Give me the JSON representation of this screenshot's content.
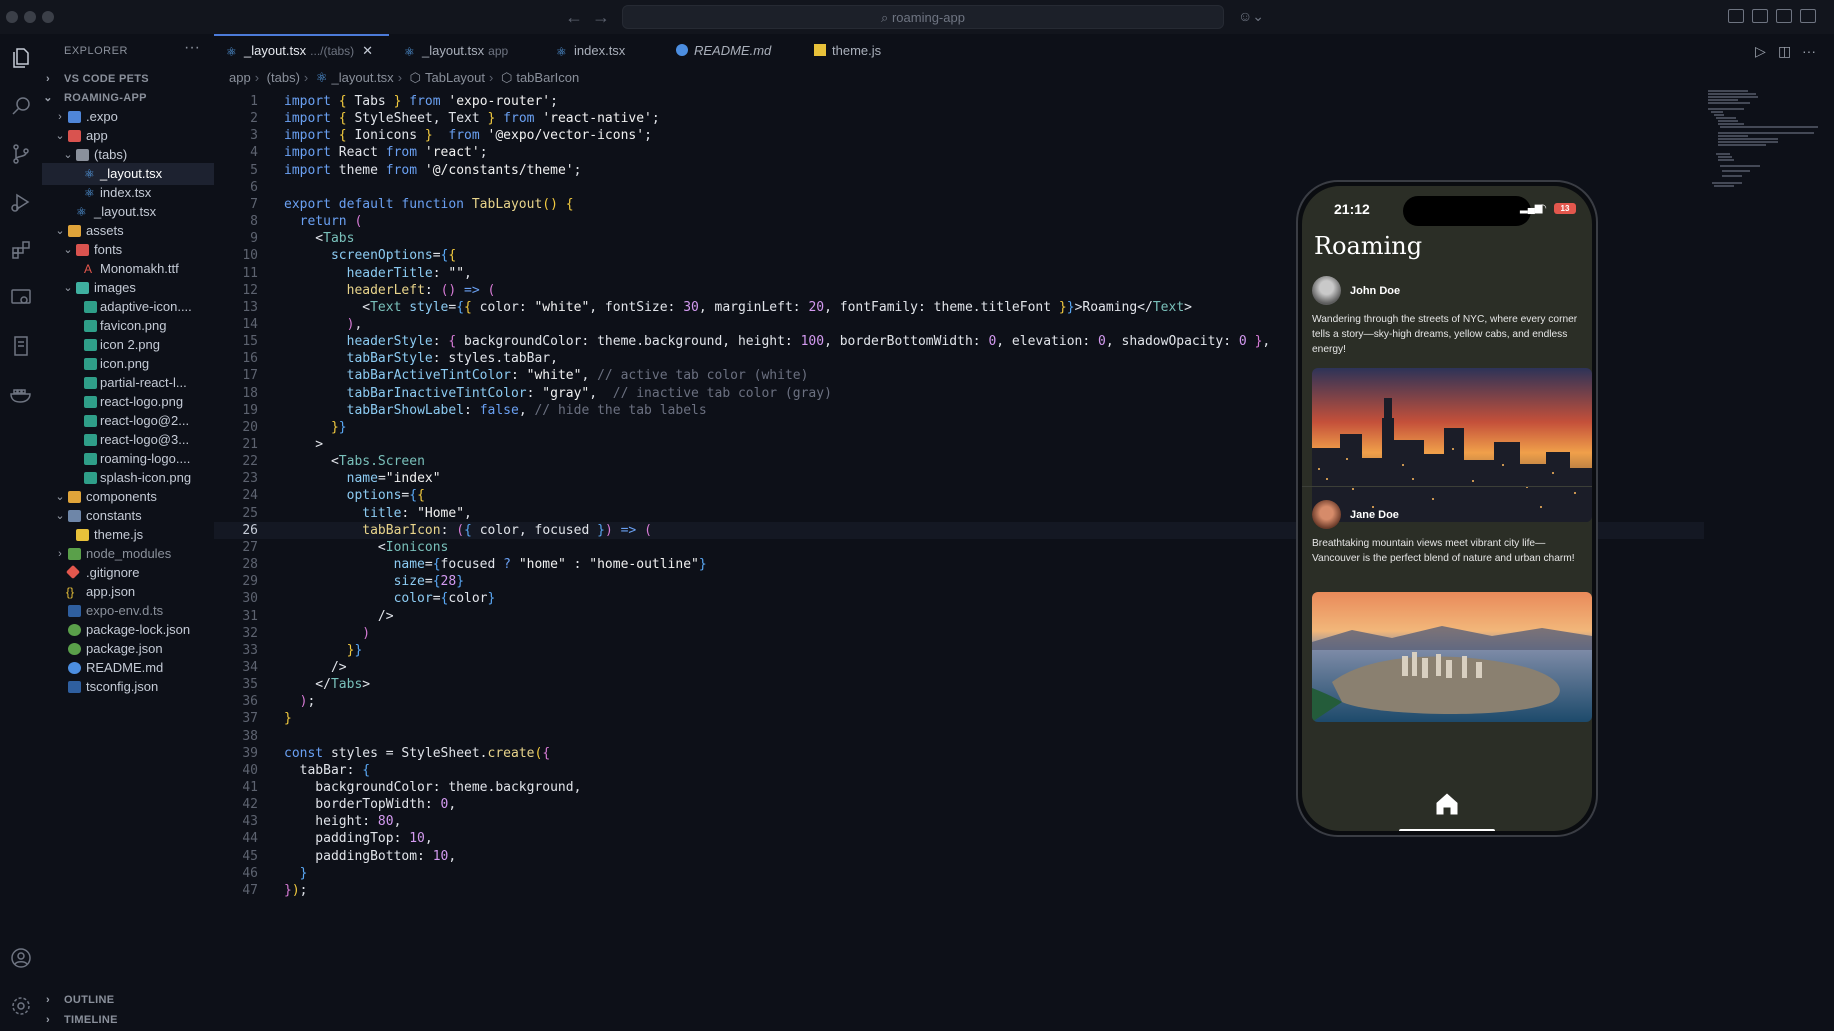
{
  "titlebar": {
    "search": "roaming-app"
  },
  "sidebar": {
    "title": "EXPLORER",
    "more": "···",
    "sections": {
      "pets": "VS CODE PETS",
      "project": "ROAMING-APP",
      "outline": "OUTLINE",
      "timeline": "TIMELINE"
    },
    "tree": [
      ".expo",
      "app",
      "(tabs)",
      "_layout.tsx",
      "index.tsx",
      "_layout.tsx",
      "assets",
      "fonts",
      "Monomakh.ttf",
      "images",
      "adaptive-icon....",
      "favicon.png",
      "icon 2.png",
      "icon.png",
      "partial-react-l...",
      "react-logo.png",
      "react-logo@2...",
      "react-logo@3...",
      "roaming-logo....",
      "splash-icon.png",
      "components",
      "constants",
      "theme.js",
      "node_modules",
      ".gitignore",
      "app.json",
      "expo-env.d.ts",
      "package-lock.json",
      "package.json",
      "README.md",
      "tsconfig.json"
    ]
  },
  "tabs": [
    {
      "label": "_layout.tsx",
      "sub": ".../(tabs)",
      "close": "✕"
    },
    {
      "label": "_layout.tsx",
      "sub": "app"
    },
    {
      "label": "index.tsx"
    },
    {
      "label": "README.md"
    },
    {
      "label": "theme.js"
    }
  ],
  "breadcrumb": [
    "app",
    "(tabs)",
    "_layout.tsx",
    "TabLayout",
    "tabBarIcon"
  ],
  "line_numbers": [
    "1",
    "2",
    "3",
    "4",
    "5",
    "6",
    "7",
    "8",
    "9",
    "10",
    "11",
    "12",
    "13",
    "14",
    "15",
    "16",
    "17",
    "18",
    "19",
    "20",
    "21",
    "22",
    "23",
    "24",
    "25",
    "26",
    "27",
    "28",
    "29",
    "30",
    "31",
    "32",
    "33",
    "34",
    "35",
    "36",
    "37",
    "38",
    "39",
    "40",
    "41",
    "42",
    "43",
    "44",
    "45",
    "46",
    "47"
  ],
  "phone": {
    "time": "21:12",
    "battery": "13",
    "title": "Roaming",
    "posts": [
      {
        "name": "John Doe",
        "text": "Wandering through the streets of NYC, where every corner tells a story—sky-high dreams, yellow cabs, and endless energy!"
      },
      {
        "name": "Jane Doe",
        "text": "Breathtaking mountain views meet vibrant city life—Vancouver is the perfect blend of nature and urban charm!"
      }
    ]
  },
  "colors": {
    "accent": "#4c7bd9",
    "phone_bg": "#2b2e26",
    "editor_bg": "#0d1018"
  },
  "icons": [
    "files-icon",
    "search-icon",
    "source-control-icon",
    "run-debug-icon",
    "extensions-icon",
    "remote-explorer-icon",
    "testing-icon",
    "docker-icon",
    "account-icon",
    "settings-icon",
    "home-icon"
  ]
}
